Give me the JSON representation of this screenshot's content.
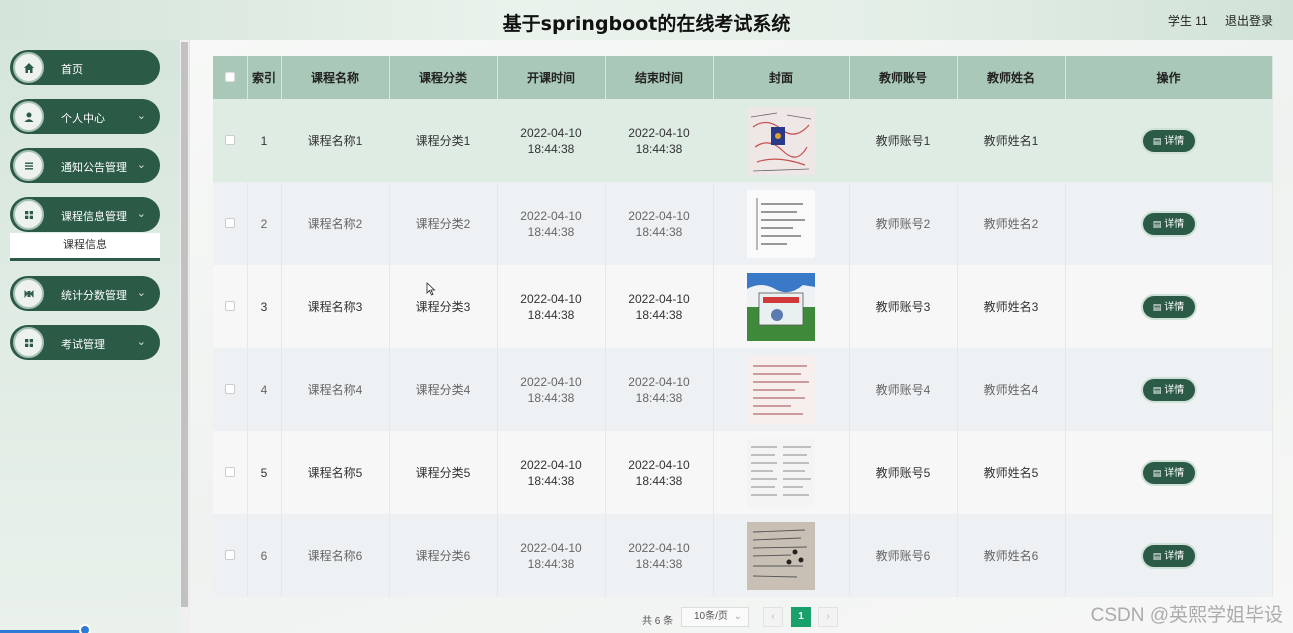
{
  "header": {
    "title": "基于springboot的在线考试系统",
    "user": "学生 11",
    "logout": "退出登录"
  },
  "sidebar": {
    "items": [
      {
        "label": "首页",
        "icon": "home-icon",
        "chevron": false
      },
      {
        "label": "个人中心",
        "icon": "user-icon",
        "chevron": true
      },
      {
        "label": "通知公告管理",
        "icon": "list-icon",
        "chevron": true
      },
      {
        "label": "课程信息管理",
        "icon": "grid-icon",
        "chevron": true
      },
      {
        "label": "统计分数管理",
        "icon": "chart-icon",
        "chevron": true
      },
      {
        "label": "考试管理",
        "icon": "grid-icon",
        "chevron": true
      }
    ],
    "submenu": {
      "label": "课程信息"
    }
  },
  "table": {
    "headers": [
      "索引",
      "课程名称",
      "课程分类",
      "开课时间",
      "结束时间",
      "封面",
      "教师账号",
      "教师姓名",
      "操作"
    ],
    "detail_label": "详情",
    "rows": [
      {
        "index": "1",
        "name": "课程名称1",
        "category": "课程分类1",
        "start": "2022-04-10 18:44:38",
        "end": "2022-04-10 18:44:38",
        "account": "教师账号1",
        "teacher": "教师姓名1"
      },
      {
        "index": "2",
        "name": "课程名称2",
        "category": "课程分类2",
        "start": "2022-04-10 18:44:38",
        "end": "2022-04-10 18:44:38",
        "account": "教师账号2",
        "teacher": "教师姓名2"
      },
      {
        "index": "3",
        "name": "课程名称3",
        "category": "课程分类3",
        "start": "2022-04-10 18:44:38",
        "end": "2022-04-10 18:44:38",
        "account": "教师账号3",
        "teacher": "教师姓名3"
      },
      {
        "index": "4",
        "name": "课程名称4",
        "category": "课程分类4",
        "start": "2022-04-10 18:44:38",
        "end": "2022-04-10 18:44:38",
        "account": "教师账号4",
        "teacher": "教师姓名4"
      },
      {
        "index": "5",
        "name": "课程名称5",
        "category": "课程分类5",
        "start": "2022-04-10 18:44:38",
        "end": "2022-04-10 18:44:38",
        "account": "教师账号5",
        "teacher": "教师姓名5"
      },
      {
        "index": "6",
        "name": "课程名称6",
        "category": "课程分类6",
        "start": "2022-04-10 18:44:38",
        "end": "2022-04-10 18:44:38",
        "account": "教师账号6",
        "teacher": "教师姓名6"
      }
    ]
  },
  "pagination": {
    "total": "共 6 条",
    "page_size": "10条/页",
    "prev": "‹",
    "next": "›",
    "current": "1"
  },
  "watermark": "CSDN @英熙学姐毕设",
  "colors": {
    "primary": "#2b5a46",
    "header_row": "#a9c8b7",
    "page_active": "#1aa06a"
  }
}
